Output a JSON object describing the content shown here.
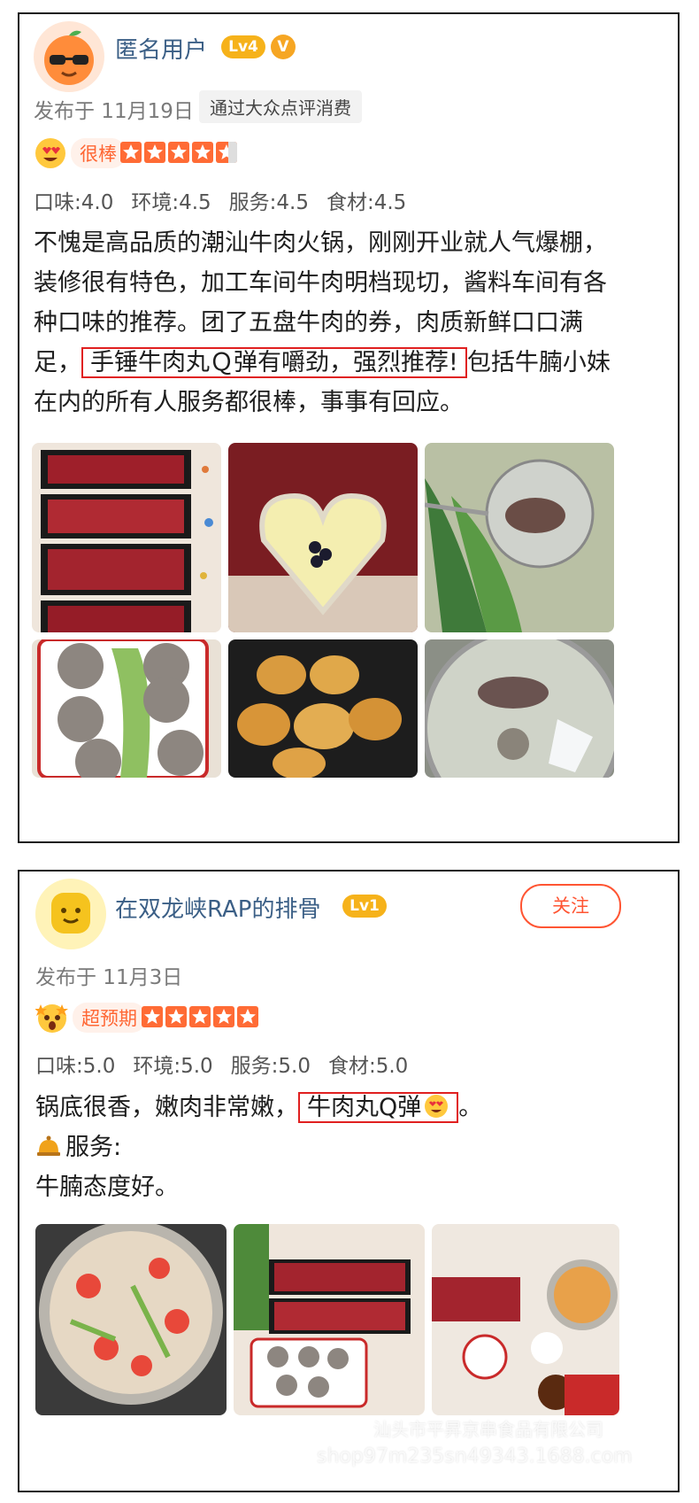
{
  "reviews": [
    {
      "username": "匿名用户",
      "level": "Lv4",
      "verified_badge": "V",
      "posted": "发布于 11月19日",
      "via_tag": "通过大众点评消费",
      "rating_tag": "很棒",
      "rating_stars": 4.5,
      "scores": [
        "口味:4.0",
        "环境:4.5",
        "服务:4.5",
        "食材:4.5"
      ],
      "text_before": "不愧是高品质的潮汕牛肉火锅，刚刚开业就人气爆棚，装修很有特色，加工车间牛肉明档现切，酱料车间有各种口味的推荐。团了五盘牛肉的券，肉质新鲜口口满足，",
      "text_highlight": "手锤牛肉丸Ｑ弹有嚼劲，强烈推荐!",
      "text_after": "包括牛腩小妹在内的所有人服务都很棒，事事有回应。",
      "photos": [
        "sliced-beef-trays",
        "heart-pudding",
        "strainer-beef-soup",
        "beef-balls-plate",
        "fried-tofu-rolls",
        "hotpot-beef-balls"
      ]
    },
    {
      "username": "在双龙峡RAP的排骨",
      "level": "Lv1",
      "follow_label": "关注",
      "posted": "发布于 11月3日",
      "rating_tag": "超预期",
      "rating_stars": 5,
      "scores": [
        "口味:5.0",
        "环境:5.0",
        "服务:5.0",
        "食材:5.0"
      ],
      "line1_before": "锅底很香，嫩肉非常嫩，",
      "line1_highlight": "牛肉丸Q弹",
      "line1_after": "。",
      "line2": "服务:",
      "line3": "牛腩态度好。",
      "photos": [
        "tomato-broth-pot",
        "beef-and-ball-platter",
        "table-spread"
      ]
    }
  ],
  "watermark": {
    "line1": "汕头市平昇京串食品有限公司",
    "line2": "shop97m235sn49343.1688.com"
  },
  "colors": {
    "accent": "#ff6b35",
    "highlight_border": "#e02020",
    "username": "#3b5f86",
    "level_badge": "#f6b21a"
  }
}
